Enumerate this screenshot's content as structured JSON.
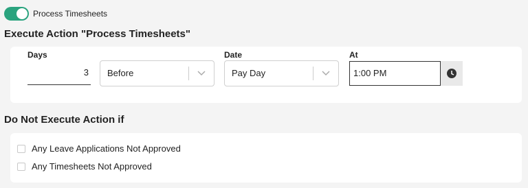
{
  "toggle": {
    "label": "Process Timesheets",
    "on": true,
    "color": "#2aa37e"
  },
  "execute": {
    "title": "Execute Action \"Process Timesheets\"",
    "days": {
      "label": "Days",
      "value": "3"
    },
    "relation": {
      "selected": "Before"
    },
    "date": {
      "label": "Date",
      "selected": "Pay Day"
    },
    "at": {
      "label": "At",
      "value": "1:00 PM",
      "icon": "clock-icon"
    }
  },
  "do_not_execute": {
    "title": "Do Not Execute Action if",
    "options": [
      {
        "label": "Any Leave Applications Not Approved",
        "checked": false
      },
      {
        "label": "Any Timesheets Not Approved",
        "checked": false
      }
    ]
  }
}
